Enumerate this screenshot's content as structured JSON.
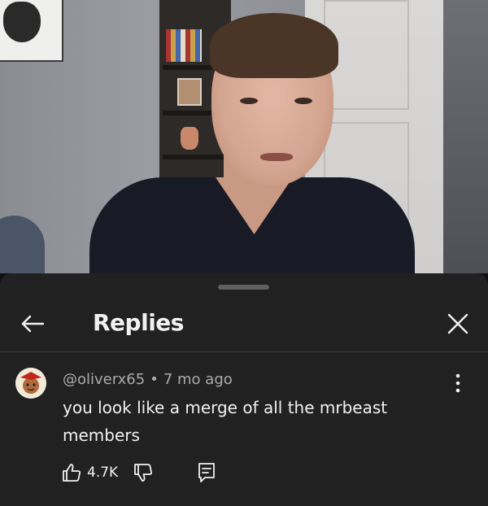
{
  "header": {
    "title": "Replies",
    "back_icon": "arrow-left-icon",
    "close_icon": "close-icon"
  },
  "comment": {
    "author": "@oliverx65",
    "separator": "•",
    "time": "7 mo ago",
    "text": "you look like a merge of all the mrbeast members",
    "likes": "4.7K",
    "icons": [
      "thumbs-up-icon",
      "thumbs-down-icon",
      "reply-icon",
      "more-vert-icon"
    ]
  },
  "colors": {
    "sheet_bg": "#212121",
    "text_primary": "#f1f1f1",
    "text_secondary": "#aaaaaa",
    "divider": "#3a3a3a"
  }
}
